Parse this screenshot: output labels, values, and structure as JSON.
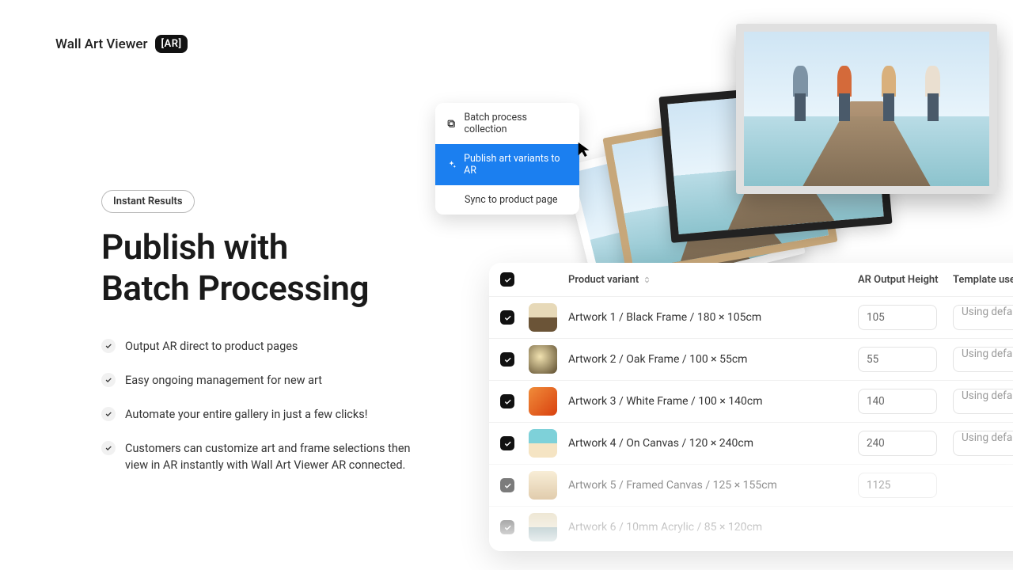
{
  "logo": {
    "text": "Wall Art Viewer",
    "badge": "[AR]"
  },
  "pill": "Instant Results",
  "headline_line1": "Publish with",
  "headline_line2": "Batch Processing",
  "bullets": [
    "Output AR direct to product pages",
    "Easy ongoing management for new art",
    "Automate your entire gallery in just a few clicks!",
    "Customers can customize art and frame selections then view in AR instantly with Wall Art Viewer AR connected."
  ],
  "menu": {
    "items": [
      {
        "label": "Batch process collection",
        "active": false
      },
      {
        "label": "Publish art variants to AR",
        "active": true
      },
      {
        "label": "Sync to product page",
        "active": false
      }
    ]
  },
  "table": {
    "headers": {
      "variant": "Product variant",
      "height": "AR Output Height",
      "template": "Template used"
    },
    "template_default_text": "Using defau",
    "rows": [
      {
        "label": "Artwork 1 / Black Frame / 180 × 105cm",
        "height": "105",
        "show_template": true,
        "thumb": "th-dock"
      },
      {
        "label": "Artwork 2 / Oak Frame / 100 × 55cm",
        "height": "55",
        "show_template": true,
        "thumb": "th-storm"
      },
      {
        "label": "Artwork 3 / White Frame / 100 × 140cm",
        "height": "140",
        "show_template": true,
        "thumb": "th-dune"
      },
      {
        "label": "Artwork 4 / On Canvas / 120 × 240cm",
        "height": "240",
        "show_template": true,
        "thumb": "th-wave"
      },
      {
        "label": "Artwork 5 / Framed Canvas / 125 × 155cm",
        "height": "1125",
        "show_template": false,
        "thumb": "th-palm",
        "fade": true
      },
      {
        "label": "Artwork 6 / 10mm Acrylic / 85 × 120cm",
        "height": "",
        "show_template": false,
        "thumb": "th-pier2",
        "fade": true
      }
    ]
  }
}
